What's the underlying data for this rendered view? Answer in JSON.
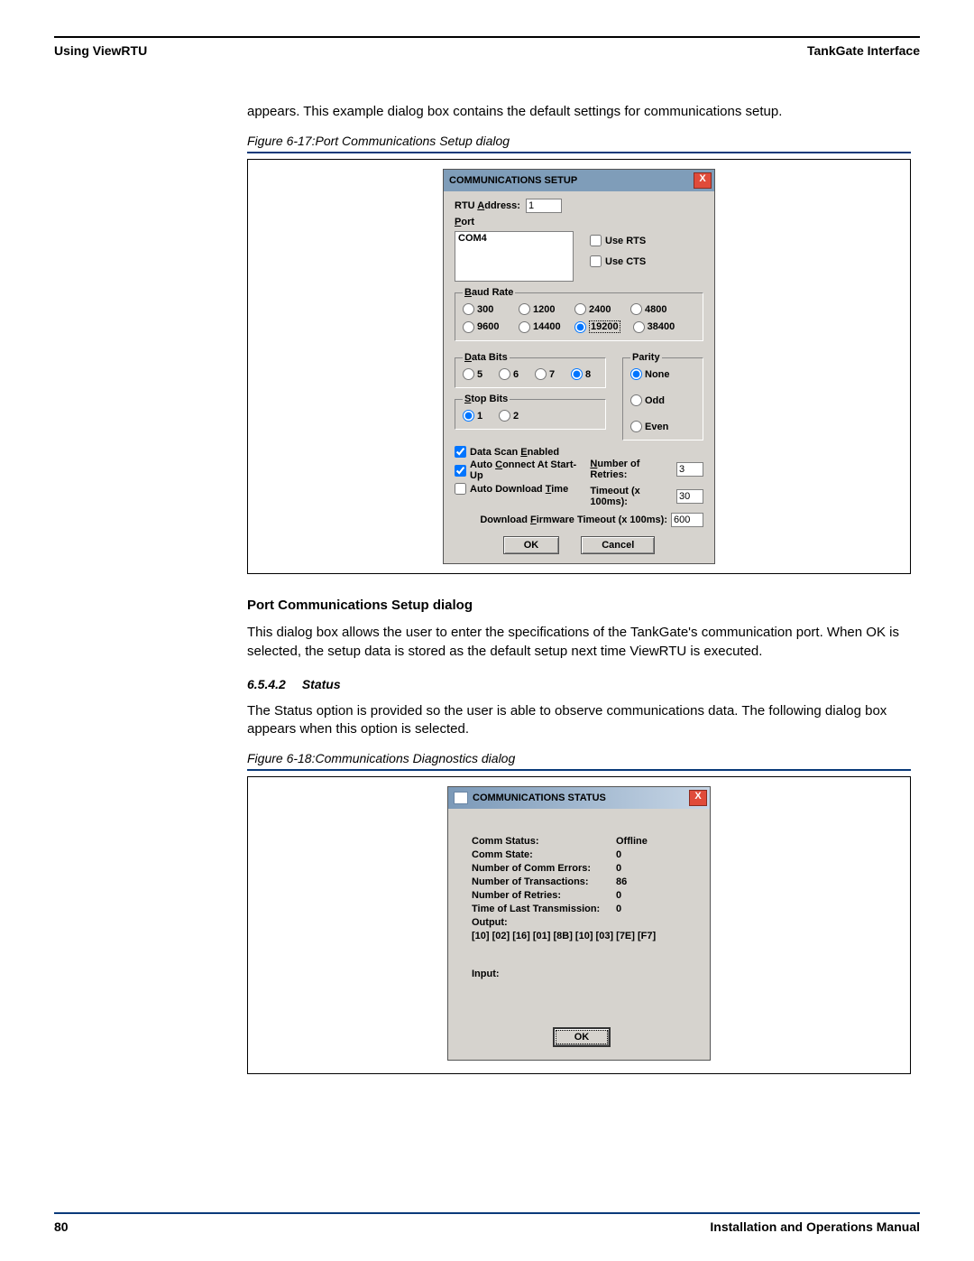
{
  "header": {
    "left": "Using ViewRTU",
    "right": "TankGate Interface"
  },
  "intro": "appears. This example dialog box contains the default settings for communications setup.",
  "fig17_caption": "Figure 6-17:Port Communications Setup dialog",
  "dlg1": {
    "title": "COMMUNICATIONS SETUP",
    "rtu_addr_label_pre": "RTU ",
    "rtu_addr_label_u": "A",
    "rtu_addr_label_post": "ddress:",
    "rtu_addr_value": "1",
    "port_label_u": "P",
    "port_label_post": "ort",
    "port_item": "COM4",
    "use_rts": "Use RTS",
    "use_cts": "Use CTS",
    "baud_legend_u": "B",
    "baud_legend_post": "aud Rate",
    "baud_options": [
      "300",
      "1200",
      "2400",
      "4800",
      "9600",
      "14400",
      "19200",
      "38400"
    ],
    "baud_selected": "19200",
    "databits_legend_u": "D",
    "databits_legend_post": "ata Bits",
    "databits_options": [
      "5",
      "6",
      "7",
      "8"
    ],
    "databits_selected": "8",
    "stopbits_legend_u": "S",
    "stopbits_legend_post": "top Bits",
    "stopbits_options": [
      "1",
      "2"
    ],
    "stopbits_selected": "1",
    "parity_legend": "Parity",
    "parity_options": [
      "None",
      "Odd",
      "Even"
    ],
    "parity_selected": "None",
    "chk_scan_pre": "Data Scan ",
    "chk_scan_u": "E",
    "chk_scan_post": "nabled",
    "chk_auto_conn_pre": "Auto ",
    "chk_auto_conn_u": "C",
    "chk_auto_conn_post": "onnect At Start-Up",
    "chk_auto_dl_pre": "Auto Download ",
    "chk_auto_dl_u": "T",
    "chk_auto_dl_post": "ime",
    "num_retries_u": "N",
    "num_retries_post": "umber of Retries:",
    "num_retries_value": "3",
    "timeout_label": "Timeout (x 100ms):",
    "timeout_value": "30",
    "dl_fw_timeout_pre": "Download ",
    "dl_fw_timeout_u": "F",
    "dl_fw_timeout_post": "irmware Timeout (x 100ms):",
    "dl_fw_timeout_value": "600",
    "ok": "OK",
    "cancel": "Cancel"
  },
  "mid": {
    "heading": "Port Communications Setup dialog",
    "para": "This dialog box allows the user to enter the specifications of the TankGate's communication port. When OK is selected, the setup data is stored as the default setup next time ViewRTU is executed."
  },
  "sec": {
    "num": "6.5.4.2",
    "title": "Status"
  },
  "status_para": "The Status option is provided so the user is able to observe communications data. The following dialog box appears when this option is selected.",
  "fig18_caption": "Figure 6-18:Communications Diagnostics dialog",
  "dlg2": {
    "title": "COMMUNICATIONS STATUS",
    "rows": [
      {
        "k": "Comm Status:",
        "v": "Offline"
      },
      {
        "k": "Comm State:",
        "v": "0"
      },
      {
        "k": "Number of Comm Errors:",
        "v": "0"
      },
      {
        "k": "Number of Transactions:",
        "v": "86"
      },
      {
        "k": "Number of Retries:",
        "v": "0"
      },
      {
        "k": "Time of Last Transmission:",
        "v": "0"
      }
    ],
    "output_label": "Output:",
    "output_value": "[10] [02] [16] [01] [8B] [10] [03] [7E] [F7]",
    "input_label": "Input:",
    "ok": "OK"
  },
  "footer": {
    "page": "80",
    "doc": "Installation and Operations Manual"
  }
}
